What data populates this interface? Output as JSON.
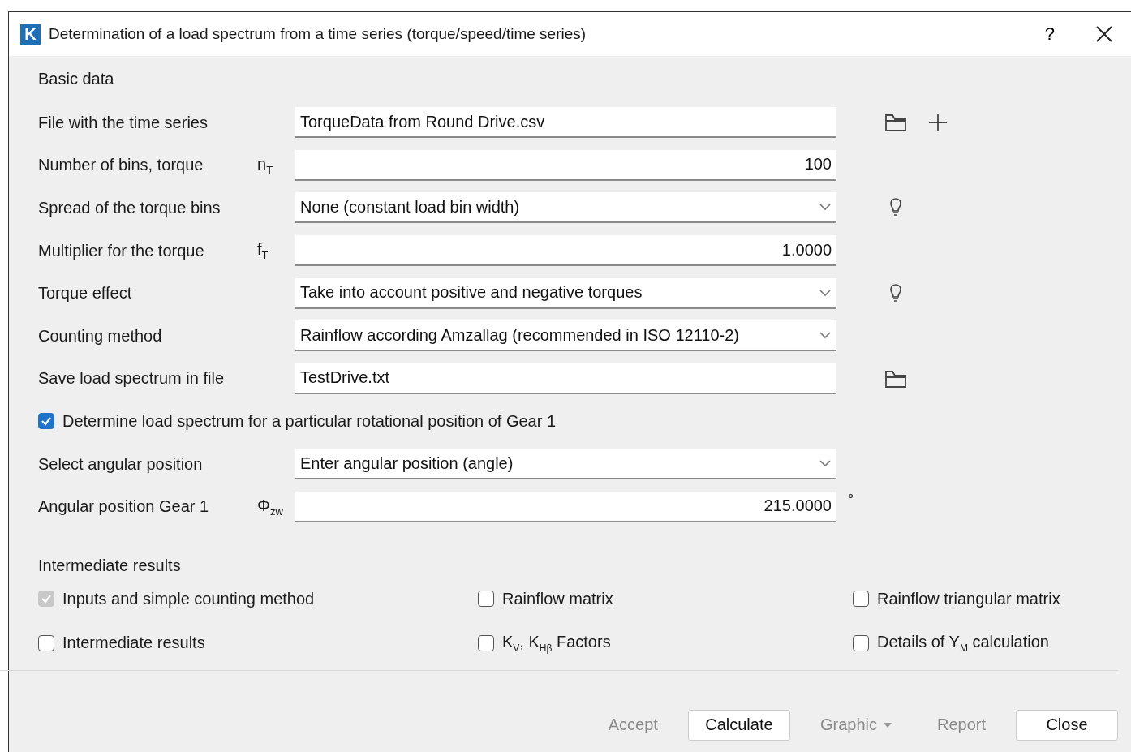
{
  "window": {
    "logo": "K",
    "title": "Determination of a load spectrum from a time series (torque/speed/time series)",
    "help": "?"
  },
  "basic_data": {
    "heading": "Basic data",
    "rows": [
      {
        "kind": "text",
        "label": "File with the time series",
        "value": "TorqueData from Round Drive.csv",
        "actions": [
          {
            "kind": "folder"
          },
          {
            "kind": "add"
          }
        ]
      },
      {
        "kind": "number",
        "label": "Number of bins, torque",
        "symbol": "n$_{T}$",
        "value": "100"
      },
      {
        "kind": "select",
        "label": "Spread of the torque bins",
        "value": "None (constant load bin width)",
        "actions": [
          {
            "kind": "hint"
          }
        ]
      },
      {
        "kind": "number",
        "label": "Multiplier for the torque",
        "symbol": "f$_{T}$",
        "value": "1.0000"
      },
      {
        "kind": "select",
        "label": "Torque effect",
        "value": "Take into account positive and negative torques",
        "actions": [
          {
            "kind": "hint"
          }
        ]
      },
      {
        "kind": "select",
        "label": "Counting method",
        "value": "Rainflow according Amzallag (recommended in ISO 12110-2)"
      },
      {
        "kind": "text",
        "label": "Save load spectrum in file",
        "value": "TestDrive.txt",
        "actions": [
          {
            "kind": "folder"
          }
        ]
      },
      {
        "kind": "checkbox",
        "label": "Determine load spectrum for a particular rotational position of Gear 1",
        "checked": true
      },
      {
        "kind": "select",
        "label": "Select angular position",
        "value": "Enter angular position (angle)"
      },
      {
        "kind": "number",
        "label": "Angular position Gear 1",
        "symbol": "Φ$_{zw}$",
        "value": "215.0000",
        "unit": "°"
      }
    ]
  },
  "intermediate_results": {
    "heading": "Intermediate results",
    "options": [
      {
        "label": "Inputs and simple counting method",
        "checked": true,
        "disabled": true
      },
      {
        "label": "Rainflow matrix",
        "checked": false,
        "disabled": false
      },
      {
        "label": "Rainflow triangular matrix",
        "checked": false,
        "disabled": false
      },
      {
        "label": "Intermediate results",
        "checked": false,
        "disabled": false
      },
      {
        "label": "K$_{V}$, K$_{Hβ}$ Factors",
        "checked": false,
        "disabled": false
      },
      {
        "label": "Details of Y$_{M}$ calculation",
        "checked": false,
        "disabled": false
      }
    ]
  },
  "buttons": [
    {
      "label": "Accept",
      "disabled": true,
      "dropdown": false
    },
    {
      "label": "Calculate",
      "disabled": false,
      "dropdown": false
    },
    {
      "label": "Graphic",
      "disabled": true,
      "dropdown": true
    },
    {
      "label": "Report",
      "disabled": true,
      "dropdown": false
    },
    {
      "label": "Close",
      "disabled": false,
      "dropdown": false
    }
  ]
}
